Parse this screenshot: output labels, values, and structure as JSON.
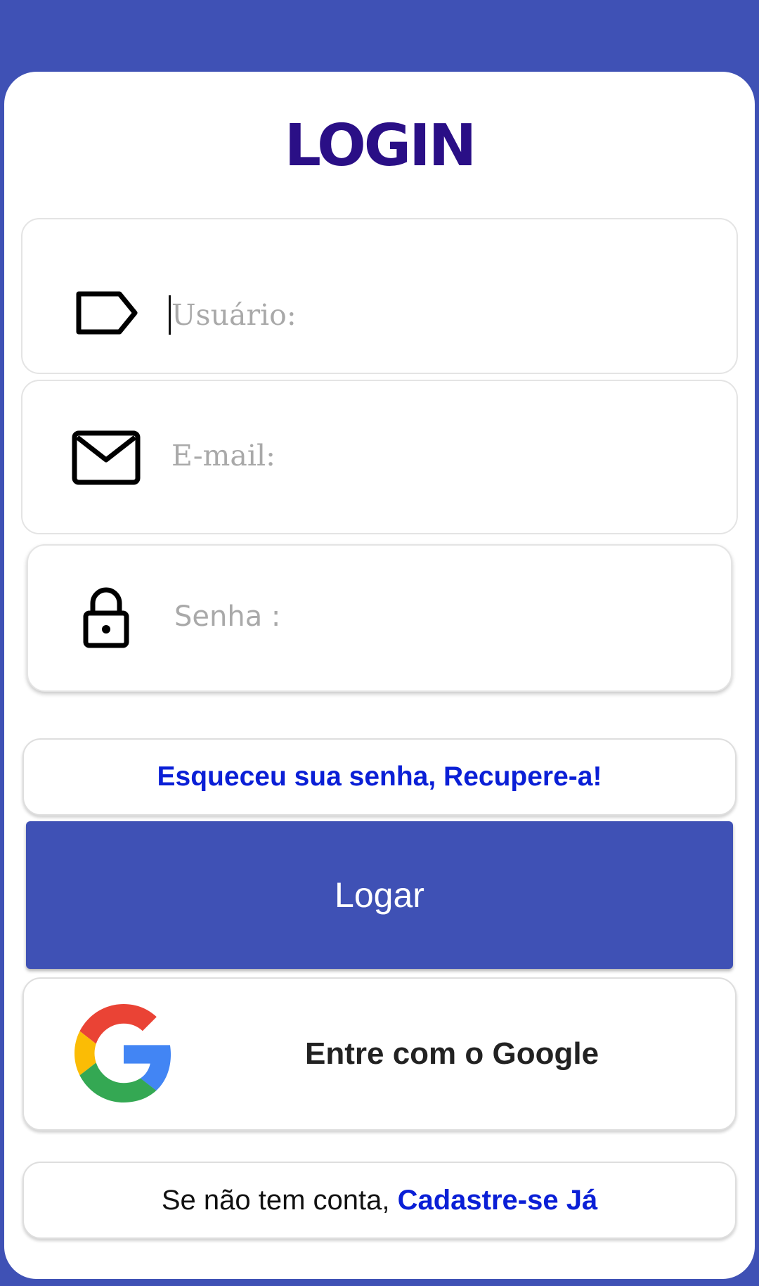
{
  "header": {
    "title": "LOGIN"
  },
  "form": {
    "username": {
      "placeholder": "Usuário:",
      "icon": "label-tag-icon"
    },
    "email": {
      "placeholder": "E-mail:",
      "icon": "mail-icon"
    },
    "password": {
      "placeholder": "Senha :",
      "icon": "lock-icon"
    }
  },
  "actions": {
    "forgot_password": "Esqueceu sua senha, Recupere-a!",
    "login_button": "Logar",
    "google_button": "Entre com o Google",
    "signup_prefix": "Se não tem conta, ",
    "signup_link": "Cadastre-se Já"
  },
  "colors": {
    "background": "#3f51b5",
    "title": "#2a0f86",
    "link": "#0a1fd6",
    "button": "#3f51b5"
  }
}
